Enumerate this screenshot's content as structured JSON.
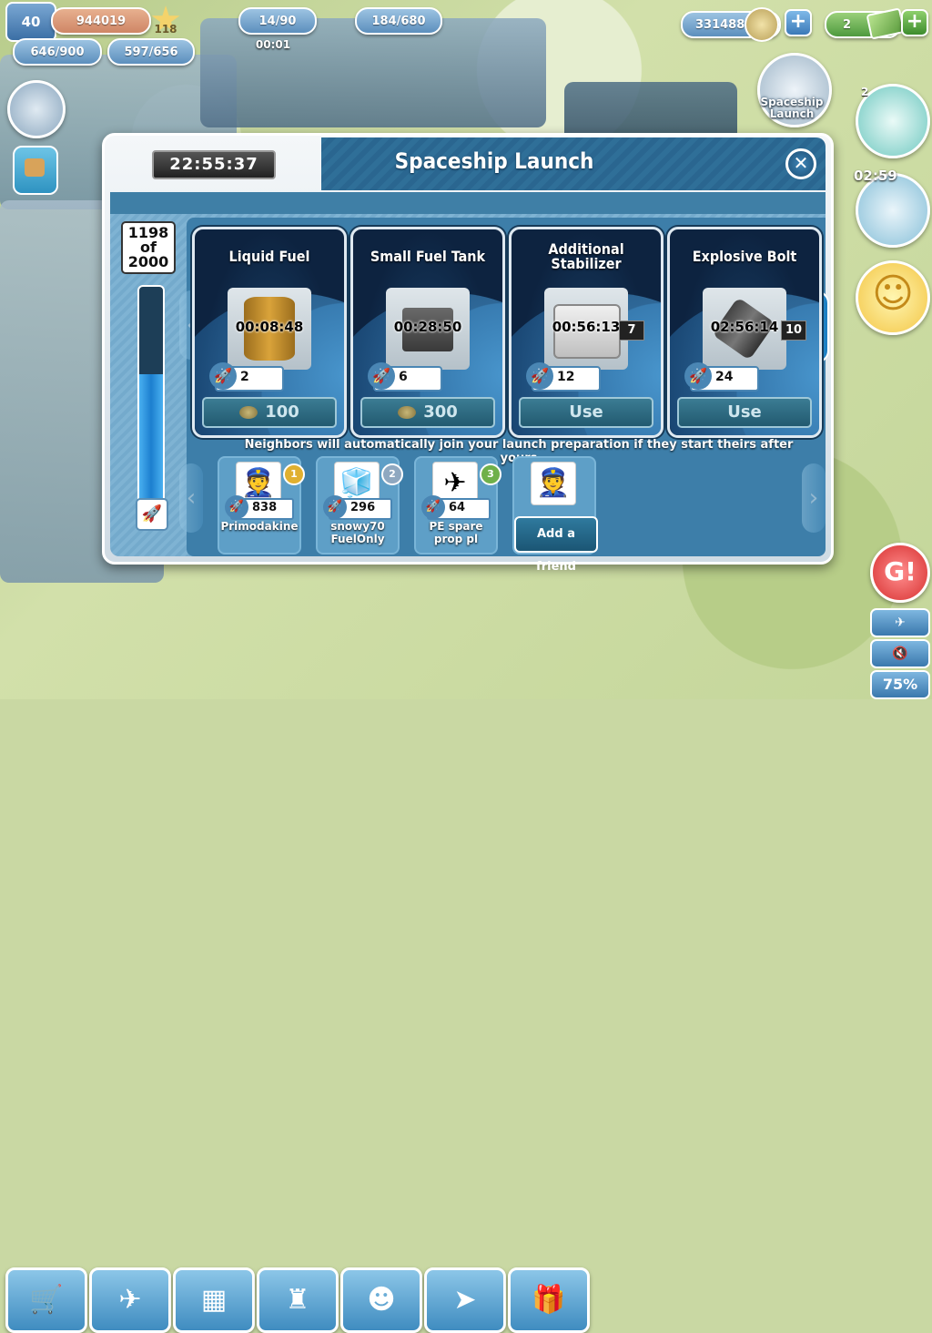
{
  "hud": {
    "level": "40",
    "xp": "944019",
    "stars": "118",
    "population_a": "646/900",
    "population_b": "597/656",
    "fuel": "14/90",
    "fuel_timer": "00:01",
    "cargo": "184/680",
    "coins": "331488",
    "cash": "2"
  },
  "side": {
    "spaceship_launch_label": "Spaceship Launch",
    "tower_count": "2",
    "plane_timer": "02:59",
    "zoom": "75%"
  },
  "dialog": {
    "title": "Spaceship Launch",
    "timer": "22:55:37",
    "close_icon": "close-icon",
    "progress": {
      "current": "1198",
      "of_label": "of",
      "total": "2000",
      "fraction": 0.599
    },
    "items": [
      {
        "title": "Liquid Fuel",
        "timer": "00:08:48",
        "rockets": "2",
        "button": "100",
        "button_type": "coins"
      },
      {
        "title": "Small Fuel Tank",
        "timer": "00:28:50",
        "rockets": "6",
        "button": "300",
        "button_type": "coins"
      },
      {
        "title": "Additional Stabilizer",
        "timer": "00:56:13",
        "count": "7",
        "rockets": "12",
        "button": "Use",
        "button_type": "use"
      },
      {
        "title": "Explosive Bolt",
        "timer": "02:56:14",
        "count": "10",
        "rockets": "24",
        "button": "Use",
        "button_type": "use"
      }
    ],
    "neighbors_text": "Neighbors will automatically join your launch preparation if they start theirs after yours",
    "friends": [
      {
        "name": "Primodakine",
        "rockets": "838",
        "medal": "1"
      },
      {
        "name": "snowy70 FuelOnly",
        "rockets": "296",
        "medal": "2"
      },
      {
        "name": "PE spare prop pl",
        "rockets": "64",
        "medal": "3"
      }
    ],
    "add_friend": "Add a friend"
  },
  "colors": {
    "header": "#2f6f98",
    "progress": "#1c7fcf",
    "medal1": "#e0b030",
    "medal2": "#8fa8c0",
    "medal3": "#6fb04a"
  }
}
